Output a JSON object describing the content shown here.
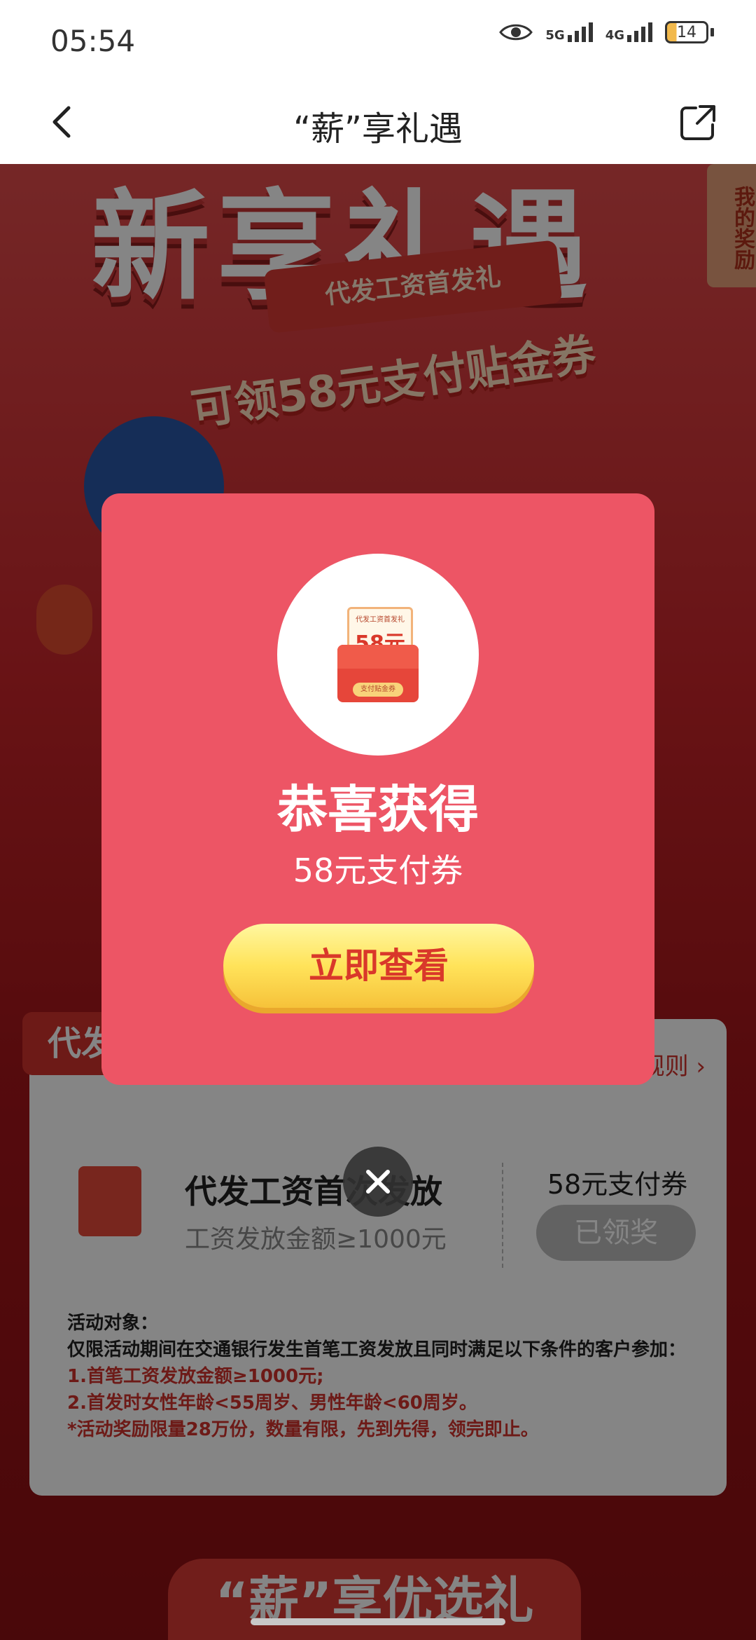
{
  "status_bar": {
    "time": "05:54",
    "network_1": "5G",
    "network_2": "4G",
    "battery": "14"
  },
  "nav": {
    "title": "“薪”享礼遇"
  },
  "banner": {
    "title": "新享礼遇",
    "ribbon": "代发工资首发礼",
    "subhead": "可领58元支付贴金券",
    "side_tab": "我的奖励"
  },
  "card": {
    "tag": "代发工资首发礼",
    "rules_link": "规则",
    "task": {
      "title": "代发工资首次发放",
      "subtitle": "工资发放金额≥1000元",
      "reward": "58元支付券",
      "button": "已领奖"
    },
    "rules": {
      "heading": "活动对象：",
      "line1": "仅限活动期间在交通银行发生首笔工资发放且同时满足以下条件的客户参加：",
      "line2": "1.首笔工资发放金额≥1000元;",
      "line3": "2.首发时女性年龄<55周岁、男性年龄<60周岁。",
      "line4": "*活动奖励限量28万份，数量有限，先到先得，领完即止。"
    }
  },
  "bottom_banner": {
    "title": "“薪”享优选礼"
  },
  "modal": {
    "coupon_small_title": "代发工资首发礼",
    "coupon_value": "58元",
    "coupon_pill": "支付贴金券",
    "title": "恭喜获得",
    "subtitle": "58元支付券",
    "button": "立即查看"
  },
  "colors": {
    "modal_bg": "#ed5565",
    "button_yellow": "#ffe35a",
    "brand_red": "#d2332d"
  }
}
